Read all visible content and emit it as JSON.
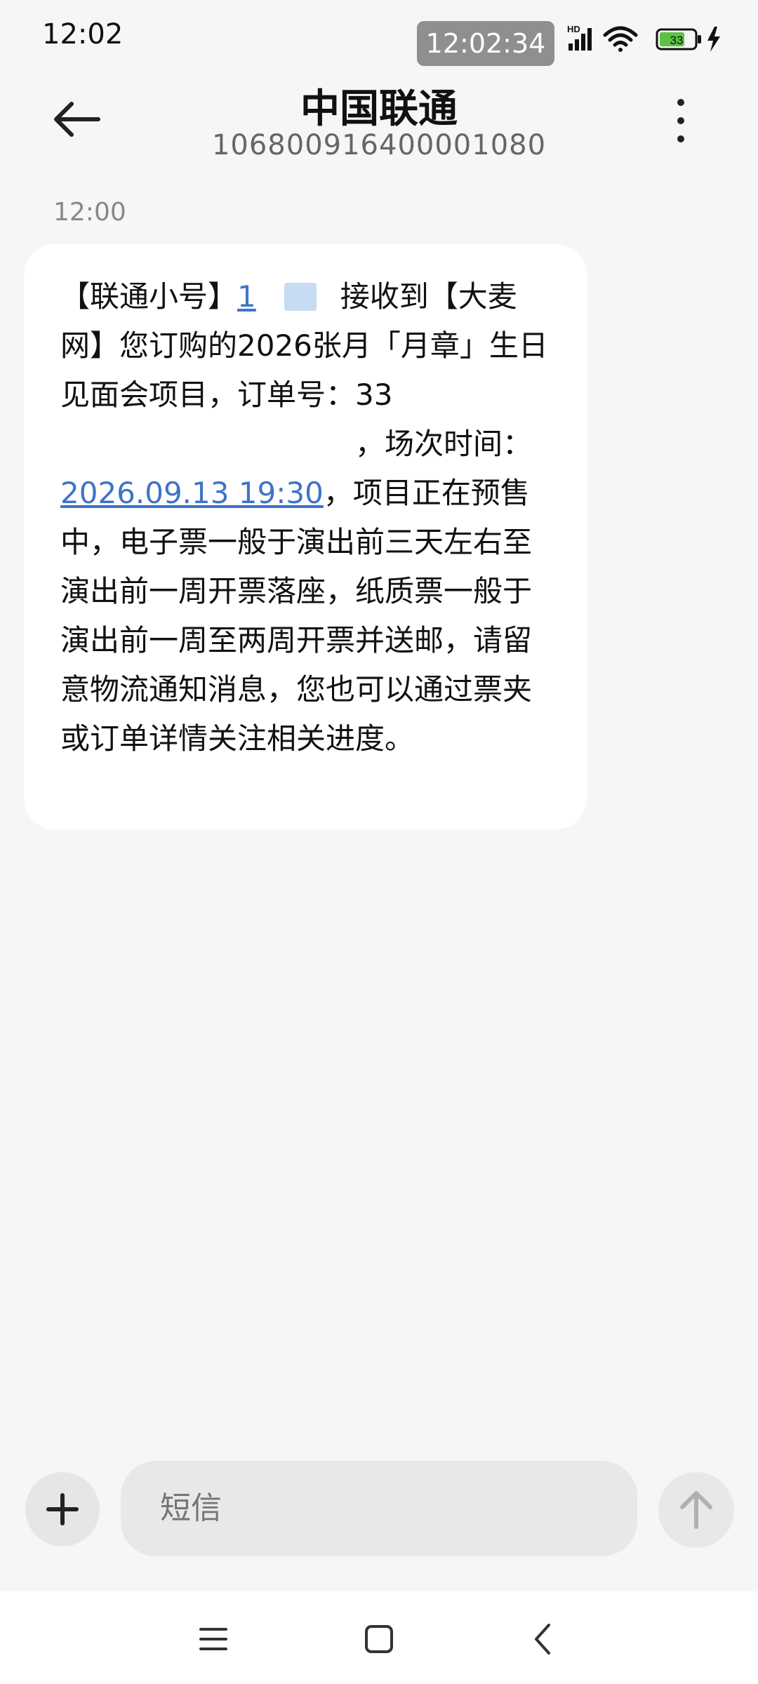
{
  "status_bar": {
    "time": "12:02",
    "clock_overlay": "12:02:34",
    "network_badge": "HD",
    "battery_level": "33",
    "icons": [
      "signal-icon",
      "wifi-icon",
      "battery-icon",
      "charging-icon"
    ]
  },
  "header": {
    "title": "中国联通",
    "subtitle": "106800916400001080",
    "icons": [
      "back-arrow-icon",
      "more-vert-icon"
    ]
  },
  "conversation": {
    "timestamp": "12:00",
    "message": {
      "part1": "【联通小号】",
      "link_number_visible": "1",
      "part2": "接收到【大麦网】您订购的2026张月「月章」生日见面会项目，订单号：",
      "order_prefix_visible": "33",
      "part3": "，场次时间：",
      "date_link": "2026.09.13 19:30",
      "part4": "，项目正在预售中，电子票一般于演出前三天左右至演出前一周开票落座，纸质票一般于演出前一周至两周开票并送邮，请留意物流通知消息，您也可以通过票夹或订单详情关注相关进度。"
    }
  },
  "composer": {
    "placeholder": "短信",
    "icons": [
      "plus-icon",
      "send-arrow-icon"
    ]
  },
  "navbar": {
    "icons": [
      "menu-icon",
      "home-icon",
      "back-icon"
    ]
  },
  "colors": {
    "background": "#f6f6f6",
    "bubble": "#ffffff",
    "link": "#3d74c7",
    "input_bg": "#e8e8e8",
    "battery_fill": "#5cc245"
  }
}
